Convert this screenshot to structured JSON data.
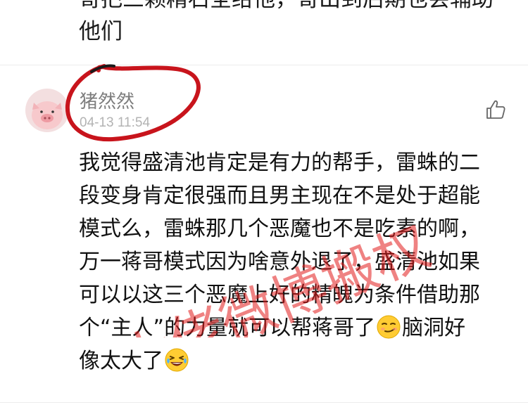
{
  "previous_comment": {
    "lines": [
      "哥把三颗精石全给他，哥出到后期也会辅助",
      "他们"
    ]
  },
  "comment": {
    "username": "猪然然",
    "timestamp": "04-13 11:54",
    "lines": [
      "我觉得盛清池肯定是有力的帮手，雷蛛的二",
      "段变身肯定很强而且男主现在不是处于超能",
      "模式么，雷蛛那几个恶魔也不是吃素的啊，",
      "万一蒋哥模式因为啥意外退了，盛清池如果",
      "可以以这三个恶魔上好的精魄为条件借助那"
    ],
    "line6_before": "个“主人”的力量就可以帮蒋哥了",
    "line6_after": "脑洞好",
    "line7": "像太大了",
    "emojis": [
      "smirk-emoji",
      "laughing-tears-emoji"
    ]
  },
  "icons": {
    "like": "thumbs-up-icon",
    "avatar": "pig-avatar"
  },
  "watermark": {
    "text": "大佬微博搬权",
    "color": "#e11b1b"
  },
  "annotation": {
    "color": "#c8141c"
  }
}
